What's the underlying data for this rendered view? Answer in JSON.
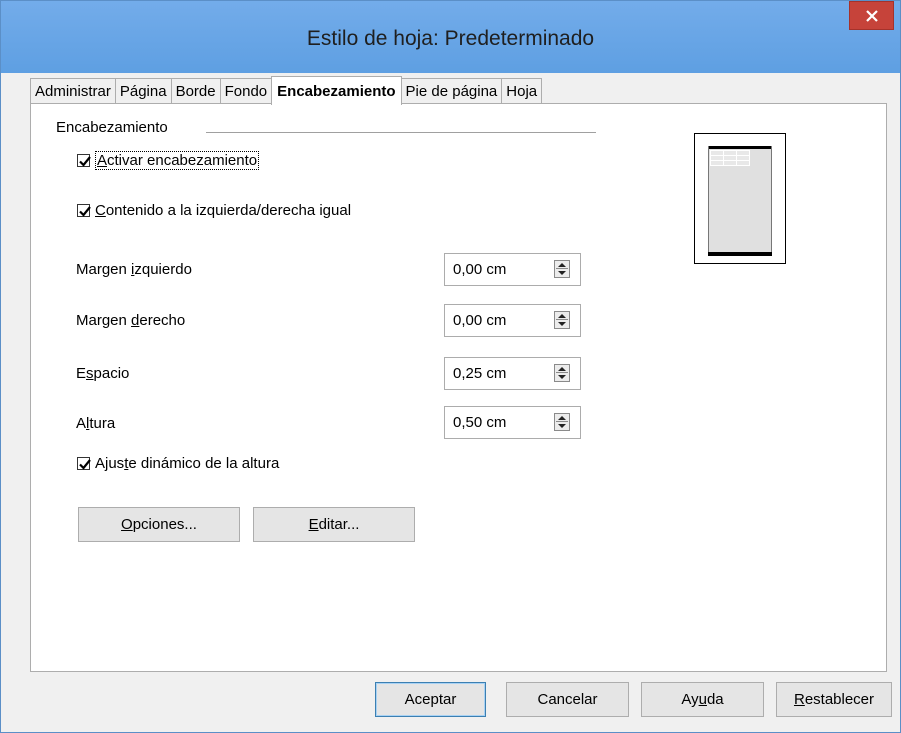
{
  "window": {
    "title": "Estilo de hoja: Predeterminado"
  },
  "tabs": [
    {
      "label": "Administrar"
    },
    {
      "label": "Página"
    },
    {
      "label": "Borde"
    },
    {
      "label": "Fondo"
    },
    {
      "label": "Encabezamiento"
    },
    {
      "label": "Pie de página"
    },
    {
      "label": "Hoja"
    }
  ],
  "active_tab": "Encabezamiento",
  "section": {
    "title": "Encabezamiento"
  },
  "checks": {
    "activate": {
      "pre": "",
      "mnemonic": "A",
      "post": "ctivar encabezamiento",
      "checked": true
    },
    "same_content": {
      "pre": "",
      "mnemonic": "C",
      "post": "ontenido a la izquierda/derecha igual",
      "checked": true
    },
    "dynamic": {
      "pre": "Ajus",
      "mnemonic": "t",
      "post": "e dinámico de la altura",
      "checked": true
    }
  },
  "fields": {
    "left_margin": {
      "pre": "Margen ",
      "mnemonic": "i",
      "post": "zquierdo",
      "value": "0,00 cm"
    },
    "right_margin": {
      "pre": "Margen ",
      "mnemonic": "d",
      "post": "erecho",
      "value": "0,00 cm"
    },
    "spacing": {
      "pre": "E",
      "mnemonic": "s",
      "post": "pacio",
      "value": "0,25 cm"
    },
    "height": {
      "pre": "A",
      "mnemonic": "l",
      "post": "tura",
      "value": "0,50 cm"
    }
  },
  "buttons": {
    "options": {
      "pre": "",
      "mnemonic": "O",
      "post": "pciones..."
    },
    "edit": {
      "pre": "",
      "mnemonic": "E",
      "post": "ditar..."
    },
    "ok": {
      "label": "Aceptar"
    },
    "cancel": {
      "label": "Cancelar"
    },
    "help": {
      "pre": "Ay",
      "mnemonic": "u",
      "post": "da"
    },
    "reset": {
      "pre": "",
      "mnemonic": "R",
      "post": "establecer"
    }
  },
  "colors": {
    "titlebar": "#6aa7e6",
    "close": "#c6433a",
    "default_button_border": "#3c7fb1"
  }
}
